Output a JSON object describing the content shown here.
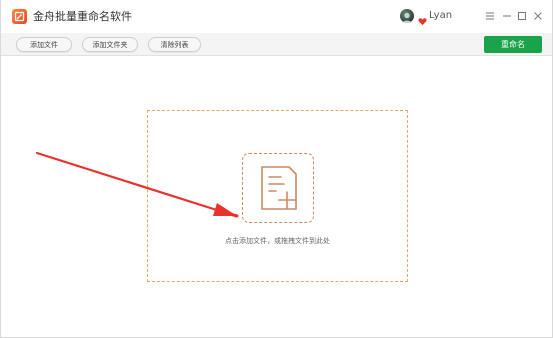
{
  "app": {
    "title": "金舟批量重命名软件",
    "logo_icon": "app-logo-icon"
  },
  "user": {
    "name": "Lyan",
    "avatar_icon": "user-avatar",
    "badge_icon": "vip-heart-icon"
  },
  "window_controls": {
    "menu_icon": "menu-icon",
    "minimize_icon": "minimize-icon",
    "maximize_icon": "maximize-icon",
    "close_icon": "close-icon"
  },
  "toolbar": {
    "add_file_label": "添加文件",
    "add_folder_label": "添加文件夹",
    "clear_list_label": "清除列表",
    "rename_label": "重命名"
  },
  "main": {
    "add_icon": "add-document-icon",
    "drop_hint": "点击添加文件，或拖拽文件到此处"
  },
  "colors": {
    "accent_green": "#1aa34a",
    "drop_border": "#e0a86a",
    "annotation_red": "#e8322a"
  }
}
